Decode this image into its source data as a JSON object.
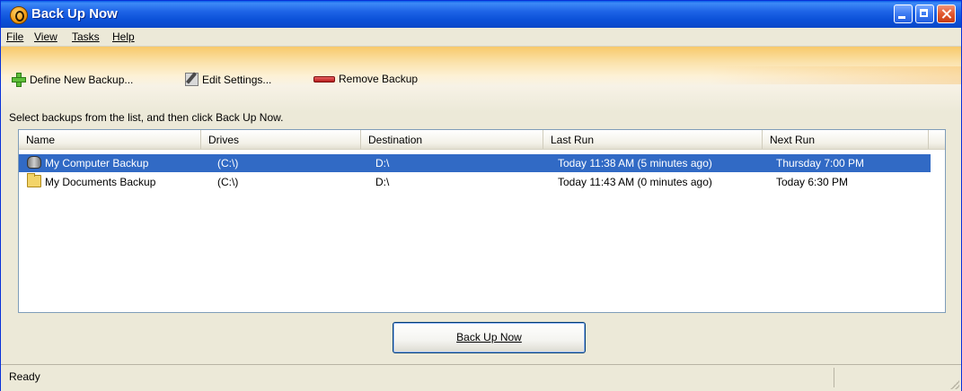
{
  "window": {
    "title": "Back Up Now"
  },
  "menu": [
    "File",
    "View",
    "Tasks",
    "Help"
  ],
  "toolbar": {
    "define": "Define New Backup...",
    "edit": "Edit Settings...",
    "remove": "Remove Backup"
  },
  "instruction": "Select backups from the list, and then click Back Up Now.",
  "columns": [
    "Name",
    "Drives",
    "Destination",
    "Last Run",
    "Next Run"
  ],
  "rows": [
    {
      "name": "My Computer Backup",
      "drives": "(C:\\)",
      "destination": "D:\\",
      "last_run": "Today 11:38 AM (5 minutes ago)",
      "next_run": "Thursday 7:00 PM",
      "icon": "drive-icon",
      "selected": true
    },
    {
      "name": "My Documents Backup",
      "drives": "(C:\\)",
      "destination": "D:\\",
      "last_run": "Today 11:43 AM (0 minutes ago)",
      "next_run": "Today 6:30 PM",
      "icon": "folder-icon",
      "selected": false
    }
  ],
  "action_button": "Back Up Now",
  "status": "Ready",
  "colors": {
    "selection": "#316ac5",
    "titlebar": "#0a54e0"
  }
}
